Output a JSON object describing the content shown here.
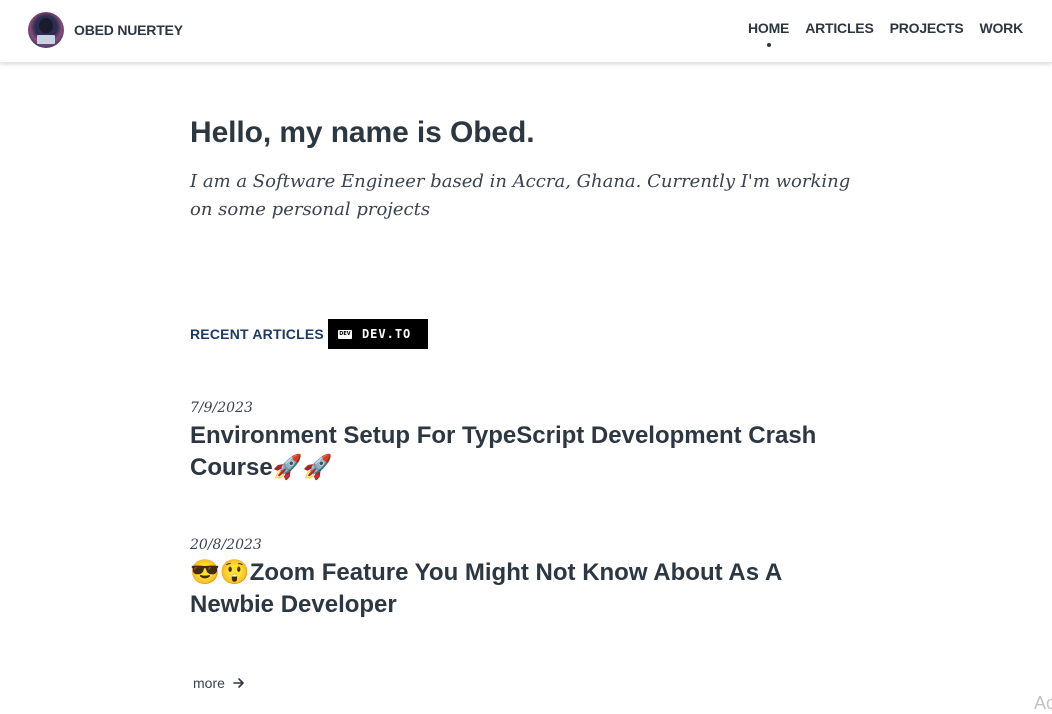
{
  "header": {
    "brand_name": "OBED NUERTEY",
    "avatar_icon": "profile-avatar",
    "nav": [
      {
        "label": "HOME",
        "active": true
      },
      {
        "label": "ARTICLES",
        "active": false
      },
      {
        "label": "PROJECTS",
        "active": false
      },
      {
        "label": "WORK",
        "active": false
      }
    ]
  },
  "intro": {
    "title": "Hello, my name is Obed.",
    "text": "I am a Software Engineer based in Accra, Ghana. Currently I'm working on some personal projects"
  },
  "recent": {
    "label": "RECENT ARTICLES",
    "badge_logo": "DEV",
    "badge_text": "DEV.TO"
  },
  "articles": [
    {
      "date": "7/9/2023",
      "title": "Environment Setup For TypeScript Development Crash Course🚀🚀"
    },
    {
      "date": "20/8/2023",
      "title": "😎😲Zoom Feature You Might Not Know About As A Newbie Developer"
    }
  ],
  "more": {
    "label": "more",
    "icon": "arrow-right-icon"
  },
  "watermark": "Act",
  "colors": {
    "text": "#2d3742",
    "accent": "#1e3a68",
    "badge_bg": "#000000"
  }
}
